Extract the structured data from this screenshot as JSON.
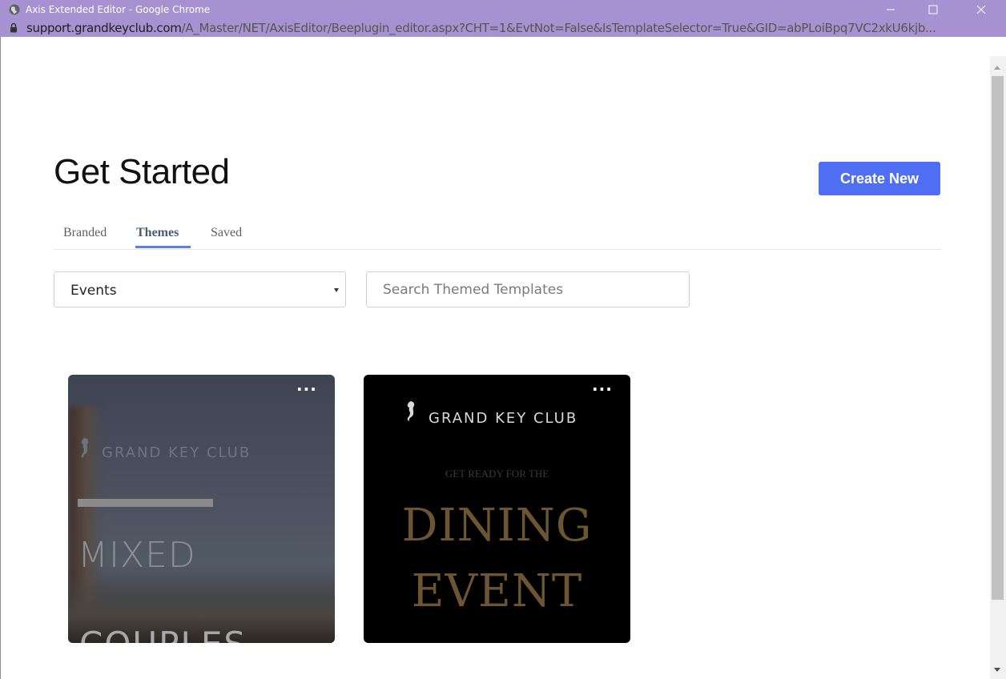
{
  "window": {
    "title": "Axis Extended Editor - Google Chrome",
    "url_host": "support.grandkeyclub.com",
    "url_path": "/A_Master/NET/AxisEditor/Beeplugin_editor.aspx?CHT=1&EvtNot=False&IsTemplateSelector=True&GID=abPLoiBpq7VC2xkU6kjb...",
    "titlebar_color": "#a692d0"
  },
  "page": {
    "title": "Get Started",
    "create_button": "Create New",
    "accent_color": "#4f6ef2"
  },
  "tabs": [
    {
      "label": "Branded",
      "active": false
    },
    {
      "label": "Themes",
      "active": true
    },
    {
      "label": "Saved",
      "active": false
    }
  ],
  "filters": {
    "category_selected": "Events",
    "search_placeholder": "Search Themed Templates"
  },
  "templates": [
    {
      "more_label": "...",
      "logo_text": "GRAND KEY CLUB",
      "headline": "MIXED",
      "headline2": "COUPLES"
    },
    {
      "more_label": "...",
      "logo_text": "GRAND KEY CLUB",
      "kicker": "GET READY FOR THE",
      "title_line1": "DINING",
      "title_line2": "EVENT"
    }
  ]
}
